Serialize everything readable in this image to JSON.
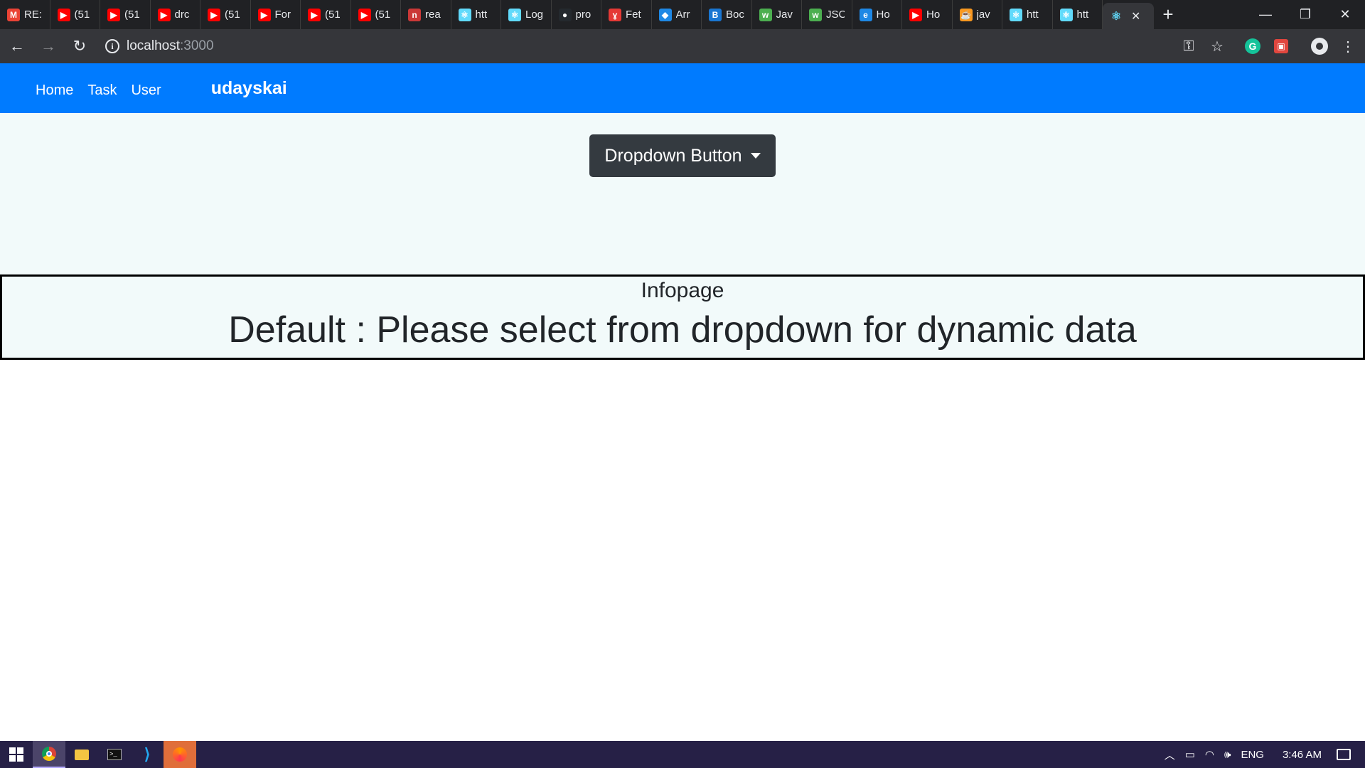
{
  "browser": {
    "tabs": [
      {
        "title": "RE:",
        "icon": "gmail-icon",
        "color": "#ea4335",
        "glyph": "M"
      },
      {
        "title": "(51",
        "icon": "youtube-icon",
        "color": "#ff0000",
        "glyph": "▶"
      },
      {
        "title": "(51",
        "icon": "youtube-icon",
        "color": "#ff0000",
        "glyph": "▶"
      },
      {
        "title": "drc",
        "icon": "youtube-icon",
        "color": "#ff0000",
        "glyph": "▶"
      },
      {
        "title": "(51",
        "icon": "youtube-icon",
        "color": "#ff0000",
        "glyph": "▶"
      },
      {
        "title": "For",
        "icon": "youtube-icon",
        "color": "#ff0000",
        "glyph": "▶"
      },
      {
        "title": "(51",
        "icon": "youtube-icon",
        "color": "#ff0000",
        "glyph": "▶"
      },
      {
        "title": "(51",
        "icon": "youtube-icon",
        "color": "#ff0000",
        "glyph": "▶"
      },
      {
        "title": "rea",
        "icon": "npm-icon",
        "color": "#cb3837",
        "glyph": "n"
      },
      {
        "title": "htt",
        "icon": "react-icon",
        "color": "#61dafb",
        "glyph": "⚛"
      },
      {
        "title": "Log",
        "icon": "react-icon",
        "color": "#61dafb",
        "glyph": "⚛"
      },
      {
        "title": "pro",
        "icon": "github-icon",
        "color": "#24292e",
        "glyph": "●"
      },
      {
        "title": "Fet",
        "icon": "axios-icon",
        "color": "#e53935",
        "glyph": "ɣ"
      },
      {
        "title": "Arr",
        "icon": "site-icon",
        "color": "#1e88e5",
        "glyph": "◆"
      },
      {
        "title": "Boc",
        "icon": "bootstrap-icon",
        "color": "#1976d2",
        "glyph": "B"
      },
      {
        "title": "Jav",
        "icon": "w3schools-icon",
        "color": "#4caf50",
        "glyph": "w"
      },
      {
        "title": "JSC",
        "icon": "w3schools-icon",
        "color": "#4caf50",
        "glyph": "w"
      },
      {
        "title": "Ho",
        "icon": "edureka-icon",
        "color": "#1e88e5",
        "glyph": "e"
      },
      {
        "title": "Ho",
        "icon": "youtube-icon",
        "color": "#ff0000",
        "glyph": "▶"
      },
      {
        "title": "jav",
        "icon": "java-icon",
        "color": "#f89820",
        "glyph": "☕"
      },
      {
        "title": "htt",
        "icon": "react-icon",
        "color": "#61dafb",
        "glyph": "⚛"
      },
      {
        "title": "htt",
        "icon": "react-icon",
        "color": "#61dafb",
        "glyph": "⚛"
      }
    ],
    "active_tab": {
      "icon": "react-icon",
      "glyph": "⚛",
      "color": "#61dafb",
      "close_glyph": "✕"
    },
    "new_tab_glyph": "+",
    "window_controls": {
      "minimize": "—",
      "restore": "❐",
      "close": "✕"
    },
    "nav": {
      "back": "←",
      "forward": "→",
      "reload": "↻"
    },
    "url_host": "localhost",
    "url_port": ":3000",
    "info_glyph": "i",
    "toolbar_icons": {
      "key": "⚿",
      "star": "☆",
      "grammarly": "G",
      "ext": "▣",
      "menu": "⋮"
    }
  },
  "app": {
    "nav_links": [
      "Home",
      "Task",
      "User"
    ],
    "brand": "udayskai",
    "dropdown_label": "Dropdown Button",
    "info_title": "Infopage",
    "info_message": "Default : Please select from dropdown for dynamic data"
  },
  "taskbar": {
    "lang": "ENG",
    "time": "3:46 AM",
    "tray_icons": {
      "chevron": "︿",
      "battery": "▭",
      "wifi": "◠",
      "volume": "🕪"
    }
  },
  "colors": {
    "navbar": "#007bff",
    "dropdown": "#343a40",
    "content_bg": "#f2fafa",
    "taskbar": "#262046"
  }
}
